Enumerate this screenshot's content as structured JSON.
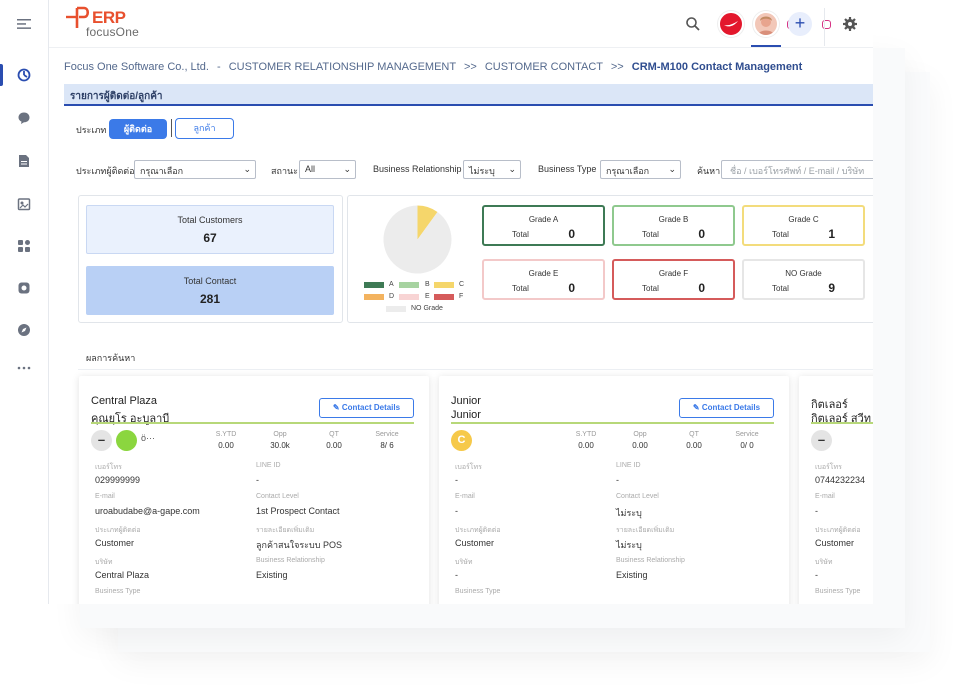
{
  "header": {
    "logo_mark": "PERP",
    "logo_text": "focusOne"
  },
  "sidebar": {
    "items": [
      "menu-icon",
      "dashboard-icon",
      "chat-icon",
      "document-icon",
      "report-icon",
      "apps-icon",
      "camera-icon",
      "compass-icon",
      "more-icon"
    ]
  },
  "breadcrumb": {
    "company": "Focus One Software Co., Ltd.",
    "sep1": "-",
    "module": "CUSTOMER RELATIONSHIP MANAGEMENT",
    "sep2": ">>",
    "section": "CUSTOMER CONTACT",
    "sep3": ">>",
    "current": "CRM-M100 Contact Management"
  },
  "section_title": "รายการผู้ติดต่อ/ลูกค้า",
  "type_selector": {
    "label": "ประเภท",
    "contact_label": "ผู้ติดต่อ",
    "customer_label": "ลูกค้า"
  },
  "filters": {
    "contact_type_label": "ประเภทผู้ติดต่อ",
    "contact_type_value": "กรุณาเลือก",
    "status_label": "สถานะ",
    "status_value": "All",
    "business_relationship_label": "Business Relationship",
    "business_relationship_value": "ไม่ระบุ",
    "business_type_label": "Business Type",
    "business_type_value": "กรุณาเลือก",
    "search_label": "ค้นหา",
    "search_placeholder": "ชื่อ / เบอร์โทรศัพท์ / E-mail / บริษัท"
  },
  "summary": {
    "total_customers_label": "Total Customers",
    "total_customers_value": "67",
    "total_contact_label": "Total Contact",
    "total_contact_value": "281"
  },
  "grade_legend": {
    "a": "A",
    "b": "B",
    "c": "C",
    "d": "D",
    "e": "E",
    "f": "F",
    "none": "NO Grade"
  },
  "grade_pie": {
    "slices": [
      {
        "grade": "C",
        "value": 1,
        "color": "#f5d66b"
      },
      {
        "grade": "NO Grade",
        "value": 9,
        "color": "#ececec"
      }
    ]
  },
  "grades": [
    {
      "title": "Grade A",
      "total_label": "Total",
      "total": "0",
      "color": "#3e7a55"
    },
    {
      "title": "Grade B",
      "total_label": "Total",
      "total": "0",
      "color": "#8fc98e"
    },
    {
      "title": "Grade C",
      "total_label": "Total",
      "total": "1",
      "color": "#f3dc7c"
    },
    {
      "title": "Grade E",
      "total_label": "Total",
      "total": "0",
      "color": "#f3c9c9"
    },
    {
      "title": "Grade F",
      "total_label": "Total",
      "total": "0",
      "color": "#d55b5b"
    },
    {
      "title": "NO Grade",
      "total_label": "Total",
      "total": "9",
      "color": "#e6e6e6"
    }
  ],
  "results_label": "ผลการค้นหา",
  "stat_headers": {
    "ytd": "S.YTD",
    "opp": "Opp",
    "qt": "QT",
    "service": "Service"
  },
  "field_labels": {
    "phone": "เบอร์โทร",
    "line": "LINE ID",
    "email": "E-mail",
    "contact_level": "Contact Level",
    "contact_type": "ประเภทผู้ติดต่อ",
    "details": "รายละเอียดเพิ่มเติม",
    "company": "บริษัท",
    "business_relationship": "Business Relationship",
    "business_type": "Business Type"
  },
  "contact_details_label": "Contact Details",
  "cards": [
    {
      "name1": "Central Plaza",
      "name2": "คุณยุโร อะบูลาบี",
      "stats": {
        "ytd": "0.00",
        "opp": "30.0k",
        "qt": "0.00",
        "service": "8/ 6"
      },
      "phone": "029999999",
      "line": "-",
      "email": "uroabudabe@a-gape.com",
      "contact_level": "1st Prospect Contact",
      "contact_type": "Customer",
      "details": "ลูกค้าสนใจระบบ POS",
      "company": "Central Plaza",
      "business_relationship": "Existing"
    },
    {
      "name1": "Junior",
      "name2": "Junior",
      "avatar_letter": "C",
      "stats": {
        "ytd": "0.00",
        "opp": "0.00",
        "qt": "0.00",
        "service": "0/ 0"
      },
      "phone": "-",
      "line": "-",
      "email": "-",
      "contact_level": "ไม่ระบุ",
      "contact_type": "Customer",
      "details": "ไม่ระบุ",
      "company": "-",
      "business_relationship": "Existing"
    },
    {
      "name1": "กิตเลอร์",
      "name2": "กิตเลอร์ สวีท",
      "phone": "0744232234",
      "email": "-",
      "contact_type": "Customer",
      "company": "-"
    }
  ]
}
